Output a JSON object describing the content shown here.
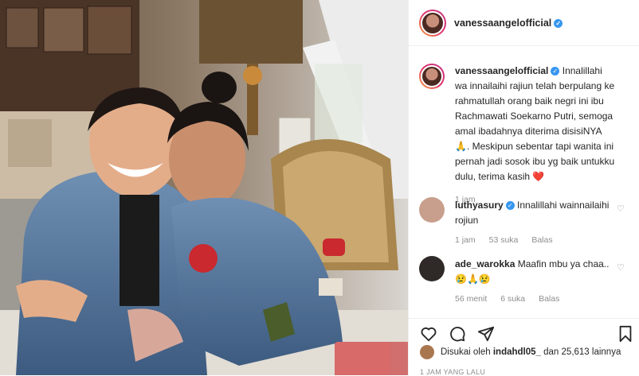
{
  "post": {
    "author": "vanessaangelofficial",
    "caption_text": "Innalillahi wa innailaihi rajiun telah berpulang ke rahmatullah orang baik negri ini ibu Rachmawati Soekarno Putri, semoga amal ibadahnya diterima disisiNYA 🙏. Meskipun sebentar tapi wanita ini pernah jadi sosok ibu yg baik untukku dulu, terima kasih ❤️",
    "caption_time": "1 jam",
    "likes_prefix": "Disukai oleh",
    "likes_user": "indahdl05_",
    "likes_suffix": "dan 25,613 lainnya",
    "timestamp": "1 JAM YANG LALU"
  },
  "comments": [
    {
      "user": "luthyasury",
      "text": "Innalillahi wainnailaihi rojiun",
      "time": "1 jam",
      "likes": "53 suka",
      "reply": "Balas"
    },
    {
      "user": "ade_warokka",
      "text": "Maafin mbu ya chaa.. 😢🙏😢",
      "time": "56 menit",
      "likes": "6 suka",
      "reply": "Balas"
    }
  ],
  "colors": {
    "verified": "#3897f0",
    "heart_red": "#ed4956",
    "meta_gray": "#8e8e8e"
  },
  "icons": [
    "heart-icon",
    "comment-icon",
    "share-icon",
    "bookmark-icon",
    "verified-icon"
  ]
}
